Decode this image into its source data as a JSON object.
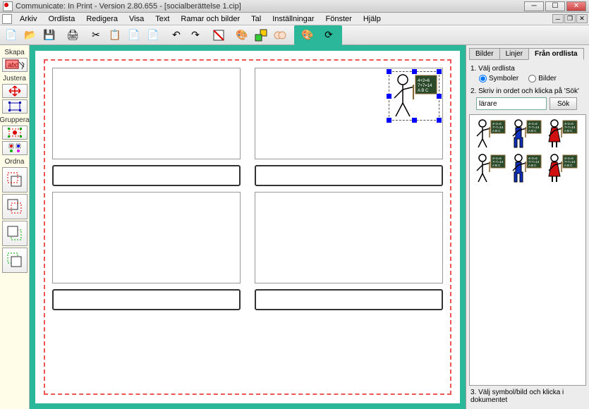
{
  "titlebar": {
    "title": "Communicate: In Print - Version 2.80.655 - [socialberättelse 1.cip]"
  },
  "menubar": {
    "items": [
      "Arkiv",
      "Ordlista",
      "Redigera",
      "Visa",
      "Text",
      "Ramar och bilder",
      "Tal",
      "Inställningar",
      "Fönster",
      "Hjälp"
    ]
  },
  "left": {
    "sections": [
      "Skapa",
      "Justera",
      "Gruppera",
      "Ordna"
    ]
  },
  "right": {
    "tabs": [
      "Bilder",
      "Linjer",
      "Från ordlista"
    ],
    "active_tab": 2,
    "step1": "1. Välj ordlista",
    "radio_symboler": "Symboler",
    "radio_bilder": "Bilder",
    "step2": "2. Skriv in ordet och klicka på 'Sök'",
    "search_value": "lärare",
    "search_btn": "Sök",
    "step3": "3. Välj symbol/bild och klicka i dokumentet"
  },
  "symbols": {
    "colors": [
      "#000000",
      "#1030c0",
      "#d01010",
      "#000000",
      "#1030c0",
      "#d01010"
    ]
  }
}
